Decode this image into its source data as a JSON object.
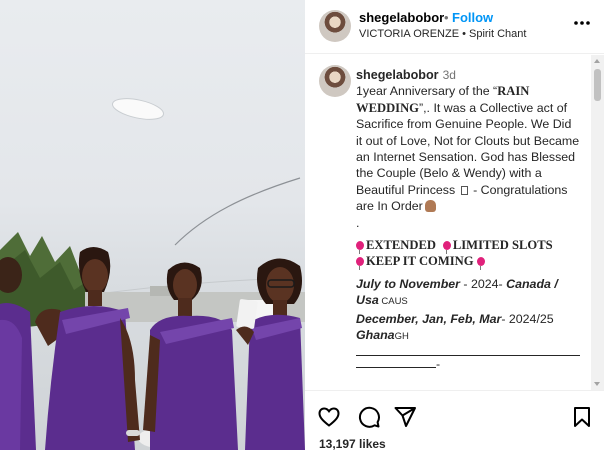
{
  "post": {
    "username": "shegelabobor",
    "follow_label": "Follow",
    "dot": "•",
    "audio": "VICTORIA ORENZE • Spirit Chant",
    "time": "3d",
    "likes": "13,197 likes"
  },
  "caption": {
    "p1_a": "1year Anniversary of the “",
    "p1_b": "RAIN WEDDING",
    "p1_c": "”,. It was a Collective act of Sacrifice from Genuine People. We Did it out of Love, Not for Clouts but Became an Internet Sensation. God has Blessed the Couple (Belo & Wendy) with a Beautiful Princess",
    "p1_d": " - Congratulations are In Order",
    "dot_line": ".",
    "bold1": "EXTENDED",
    "bold2": "LIMITED SLOTS",
    "bold3": "KEEP IT COMING",
    "tour1_dates": "July to November",
    "tour1_year": " - 2024- ",
    "tour1_place": "Canada / Usa",
    "tour1_code": " CAUS",
    "tour2_dates": "December, Jan, Feb, Mar",
    "tour2_year": "- 2024/25 ",
    "tour2_place": "Ghana",
    "tour2_code": "GH",
    "rule_end": "-"
  },
  "icons": {
    "more": "more-horizontal-icon",
    "like": "heart-icon",
    "comment": "comment-icon",
    "share": "send-icon",
    "save": "bookmark-icon",
    "scroll_up": "scroll-up-arrow",
    "scroll_down": "scroll-down-arrow"
  },
  "colors": {
    "accent_blue": "#0095f6",
    "dress_purple": "#5b2d8e",
    "balloon_pink": "#e0217b"
  }
}
